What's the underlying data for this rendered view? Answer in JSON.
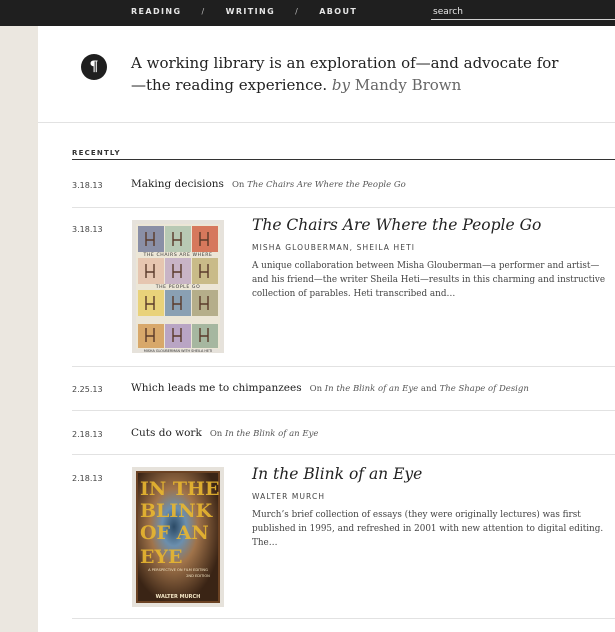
{
  "nav": {
    "items": [
      "READING",
      "WRITING",
      "ABOUT"
    ],
    "separator": "/"
  },
  "search": {
    "placeholder": "search"
  },
  "hero": {
    "icon": "pilcrow-icon",
    "icon_glyph": "¶",
    "tagline": "A working library is an exploration of—and advocate for—the reading experience.",
    "by": "by",
    "author": "Mandy Brown"
  },
  "recently_label": "RECENTLY",
  "entries": [
    {
      "date": "3.18.13",
      "title": "Making decisions",
      "on_prefix": "On",
      "on_books": [
        "The Chairs Are Where the People Go"
      ],
      "on_join": ""
    },
    {
      "date": "3.18.13",
      "book_title": "The Chairs Are Where the People Go",
      "book_author": "MISHA GLOUBERMAN, SHEILA HETI",
      "description": "A unique collaboration between Misha Glouberman—a performer and artist—and his friend—the writer Sheila Heti—results in this charming and instructive collection of parables. Heti transcribed and…",
      "cover_words": [
        "THE CHAIRS ARE WHERE",
        "THE PEOPLE GO",
        "MISHA GLOUBERMAN WITH SHEILA HETI"
      ]
    },
    {
      "date": "2.25.13",
      "title": "Which leads me to chimpanzees",
      "on_prefix": "On",
      "on_books": [
        "In the Blink of an Eye",
        "The Shape of Design"
      ],
      "on_join": "and"
    },
    {
      "date": "2.18.13",
      "title": "Cuts do work",
      "on_prefix": "On",
      "on_books": [
        "In the Blink of an Eye"
      ],
      "on_join": ""
    },
    {
      "date": "2.18.13",
      "book_title": "In the Blink of an Eye",
      "book_author": "WALTER MURCH",
      "description": "Murch’s brief collection of essays (they were originally lectures) was first published in 1995, and refreshed in 2001 with new attention to digital editing. The…",
      "cover_words": [
        "IN THE BLINK OF AN EYE",
        "A PERSPECTIVE ON FILM EDITING",
        "2ND EDITION",
        "WALTER MURCH"
      ]
    }
  ],
  "colors": {
    "topbar": "#1f1f1f",
    "sidebar": "#ebe7e0",
    "text": "#333333",
    "rule": "#e2e2e2"
  }
}
